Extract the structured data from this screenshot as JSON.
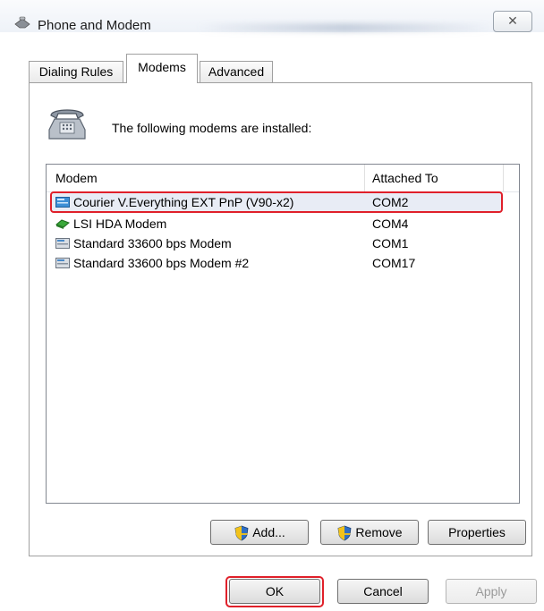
{
  "window": {
    "title": "Phone and Modem",
    "close_glyph": "✕"
  },
  "tabs": [
    {
      "label": "Dialing Rules",
      "selected": false
    },
    {
      "label": "Modems",
      "selected": true
    },
    {
      "label": "Advanced",
      "selected": false
    }
  ],
  "intro_text": "The following modems are installed:",
  "list": {
    "columns": [
      "Modem",
      "Attached To"
    ],
    "rows": [
      {
        "icon": "modem-icon",
        "name": "Courier V.Everything EXT PnP (V90-x2)",
        "port": "COM2",
        "selected": true
      },
      {
        "icon": "modem-card-icon",
        "name": "LSI HDA Modem",
        "port": "COM4",
        "selected": false
      },
      {
        "icon": "modem-icon",
        "name": "Standard 33600 bps Modem",
        "port": "COM1",
        "selected": false
      },
      {
        "icon": "modem-icon",
        "name": "Standard 33600 bps Modem #2",
        "port": "COM17",
        "selected": false
      }
    ]
  },
  "buttons": {
    "add": "Add...",
    "remove": "Remove",
    "properties": "Properties",
    "ok": "OK",
    "cancel": "Cancel",
    "apply": "Apply"
  },
  "colors": {
    "highlight_outline": "#e0202a",
    "selected_row_bg": "#e8ecf5"
  }
}
